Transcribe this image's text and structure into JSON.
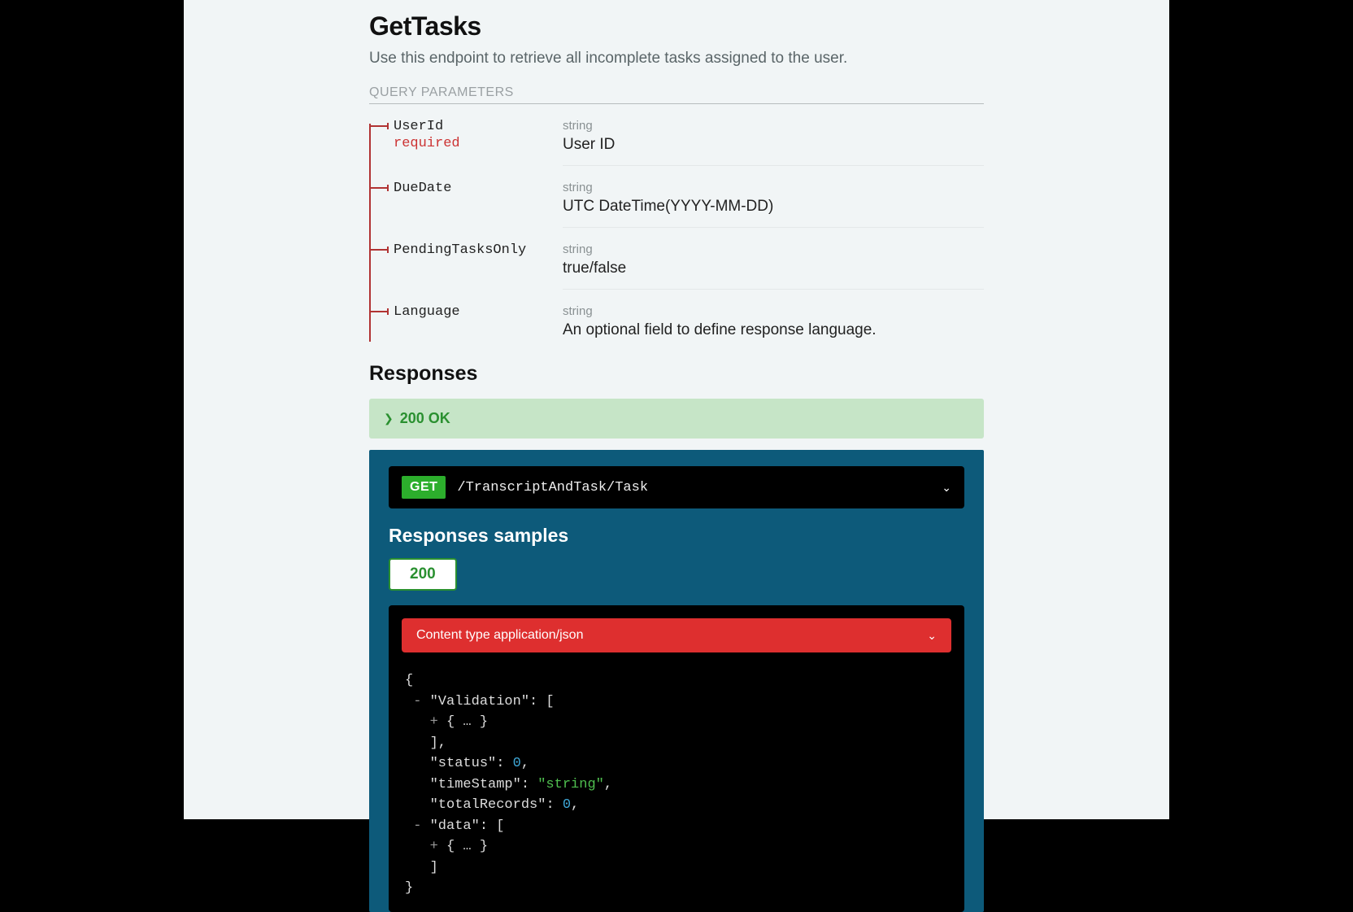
{
  "header": {
    "title": "GetTasks",
    "subtitle": "Use this endpoint to retrieve all incomplete tasks assigned to the user."
  },
  "query_section_label": "QUERY PARAMETERS",
  "params": [
    {
      "name": "UserId",
      "required_label": "required",
      "type": "string",
      "desc": "User ID"
    },
    {
      "name": "DueDate",
      "required_label": "",
      "type": "string",
      "desc": "UTC DateTime(YYYY-MM-DD)"
    },
    {
      "name": "PendingTasksOnly",
      "required_label": "",
      "type": "string",
      "desc": "true/false"
    },
    {
      "name": "Language",
      "required_label": "",
      "type": "string",
      "desc": "An optional field to define response language."
    }
  ],
  "responses_heading": "Responses",
  "response_ok": "200 OK",
  "endpoint": {
    "method": "GET",
    "path": "/TranscriptAndTask/Task"
  },
  "samples_heading": "Responses samples",
  "tab_200": "200",
  "content_type_label": "Content type application/json",
  "json": {
    "line0": "{",
    "line1_toggle": "-",
    "line1_key": "\"Validation\"",
    "line1_after": ": [",
    "line2_toggle": "+",
    "line2_body": "{ … }",
    "line3": "],",
    "line4_key": "\"status\"",
    "line4_val": "0",
    "line5_key": "\"timeStamp\"",
    "line5_val": "\"string\"",
    "line6_key": "\"totalRecords\"",
    "line6_val": "0",
    "line7_toggle": "-",
    "line7_key": "\"data\"",
    "line7_after": ": [",
    "line8_toggle": "+",
    "line8_body": "{ … }",
    "line9": "]",
    "line10": "}"
  }
}
